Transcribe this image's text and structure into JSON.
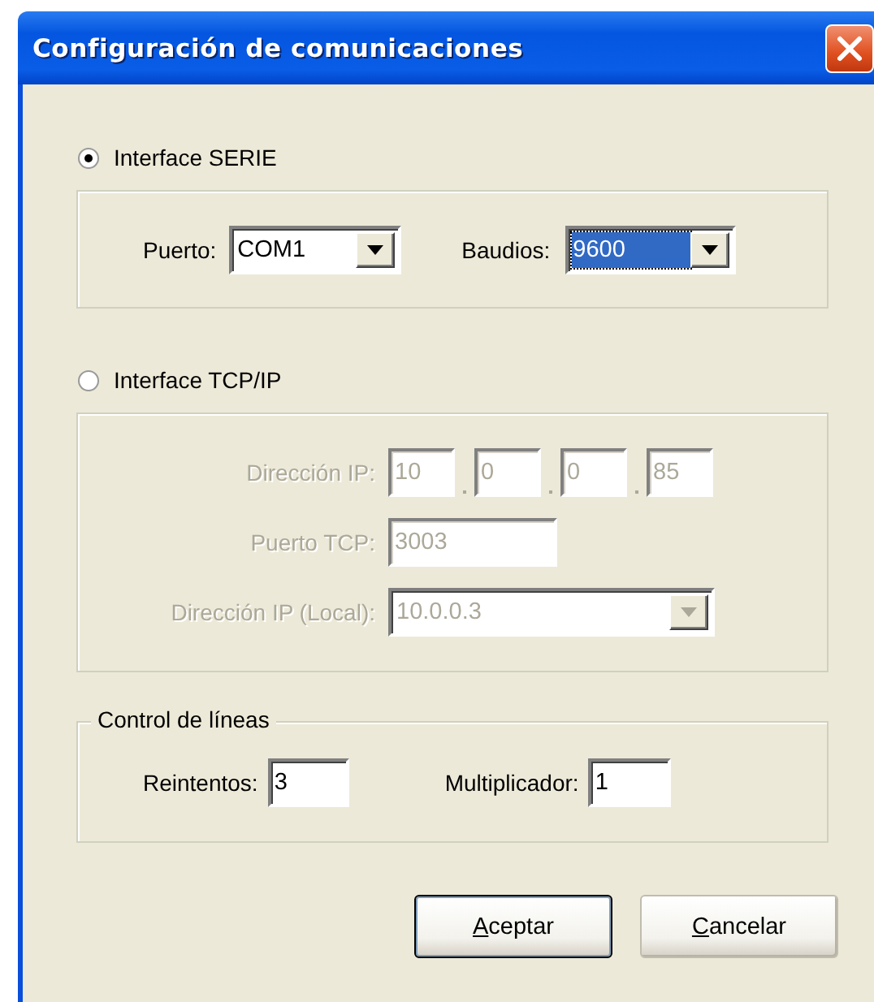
{
  "window": {
    "title": "Configuración de comunicaciones"
  },
  "serial": {
    "label": "Interface SERIE",
    "selected": true,
    "port": {
      "label": "Puerto:",
      "value": "COM1"
    },
    "baud": {
      "label": "Baudios:",
      "value": "9600",
      "focused": true
    }
  },
  "tcp": {
    "label": "Interface TCP/IP",
    "selected": false,
    "disabled": true,
    "ip": {
      "label": "Dirección IP:",
      "octets": [
        "10",
        "0",
        "0",
        "85"
      ]
    },
    "port": {
      "label": "Puerto TCP:",
      "value": "3003"
    },
    "local_ip": {
      "label": "Dirección IP (Local):",
      "value": "10.0.0.3"
    }
  },
  "line_control": {
    "title": "Control de líneas",
    "retries": {
      "label": "Reintentos:",
      "value": "3"
    },
    "multiplier": {
      "label": "Multiplicador:",
      "value": "1"
    }
  },
  "buttons": [
    {
      "label": "Aceptar",
      "default": true,
      "underline_first_letter": true
    },
    {
      "label": "Cancelar",
      "default": false,
      "underline_first_letter": true
    }
  ]
}
